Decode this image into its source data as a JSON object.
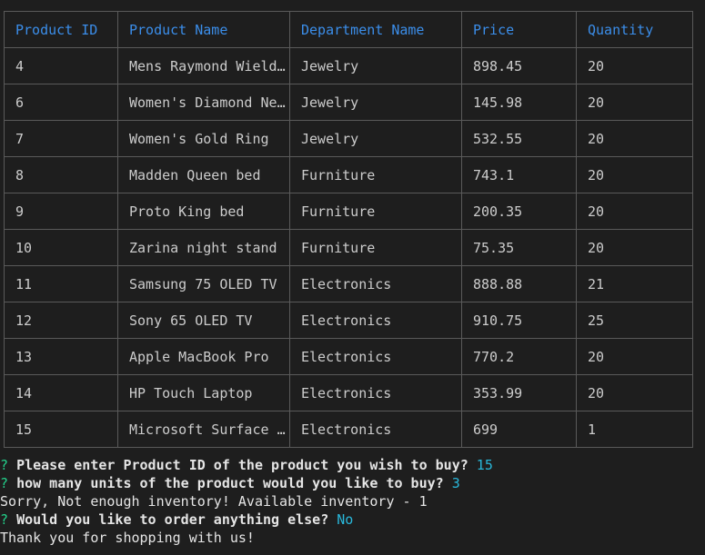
{
  "table": {
    "headers": [
      "Product ID",
      "Product Name",
      "Department Name",
      "Price",
      "Quantity"
    ],
    "rows": [
      [
        "4",
        "Mens Raymond Wielding Ring",
        "Jewelry",
        "898.45",
        "20"
      ],
      [
        "6",
        "Women's Diamond Necklace",
        "Jewelry",
        "145.98",
        "20"
      ],
      [
        "7",
        "Women's Gold Ring",
        "Jewelry",
        "532.55",
        "20"
      ],
      [
        "8",
        "Madden Queen bed",
        "Furniture",
        "743.1",
        "20"
      ],
      [
        "9",
        "Proto King bed",
        "Furniture",
        "200.35",
        "20"
      ],
      [
        "10",
        "Zarina night stand",
        "Furniture",
        "75.35",
        "20"
      ],
      [
        "11",
        "Samsung 75 OLED TV",
        "Electronics",
        "888.88",
        "21"
      ],
      [
        "12",
        "Sony 65 OLED TV",
        "Electronics",
        "910.75",
        "25"
      ],
      [
        "13",
        "Apple MacBook Pro",
        "Electronics",
        "770.2",
        "20"
      ],
      [
        "14",
        "HP Touch Laptop",
        "Electronics",
        "353.99",
        "20"
      ],
      [
        "15",
        "Microsoft Surface Laptop",
        "Electronics",
        "699",
        "1"
      ]
    ]
  },
  "session": {
    "prompt_symbol": "?",
    "q1": {
      "text": "Please enter Product ID of the product you wish to buy?",
      "answer": "15"
    },
    "q2": {
      "text": "how many units of the product would you like to buy?",
      "answer": "3"
    },
    "error_message": "Sorry, Not enough inventory! Available inventory - 1",
    "q3": {
      "text": "Would you like to order anything else?",
      "answer": "No"
    },
    "farewell": "Thank you for shopping with us!"
  },
  "colors": {
    "background": "#1e1e1e",
    "header_text": "#3b8eea",
    "prompt_marker": "#23d18b",
    "answer_text": "#29b8db",
    "border": "#5a5a5a"
  }
}
